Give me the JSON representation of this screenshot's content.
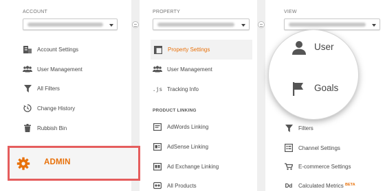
{
  "account": {
    "heading": "ACCOUNT",
    "items": [
      {
        "label": "Account Settings",
        "icon": "building-icon"
      },
      {
        "label": "User Management",
        "icon": "users-icon"
      },
      {
        "label": "All Filters",
        "icon": "filter-icon"
      },
      {
        "label": "Change History",
        "icon": "history-icon"
      },
      {
        "label": "Rubbish Bin",
        "icon": "trash-icon"
      }
    ],
    "admin_label": "ADMIN"
  },
  "property": {
    "heading": "PROPERTY",
    "items": [
      {
        "label": "Property Settings",
        "icon": "property-settings-icon"
      },
      {
        "label": "User Management",
        "icon": "users-icon"
      },
      {
        "label": "Tracking Info",
        "icon": "js-icon"
      }
    ],
    "section_heading": "PRODUCT LINKING",
    "linking": [
      {
        "label": "AdWords Linking",
        "icon": "adwords-icon"
      },
      {
        "label": "AdSense Linking",
        "icon": "adsense-icon"
      },
      {
        "label": "Ad Exchange Linking",
        "icon": "adexchange-icon"
      },
      {
        "label": "All Products",
        "icon": "all-products-icon"
      }
    ]
  },
  "view": {
    "heading": "VIEW",
    "items": [
      {
        "label": "Filters",
        "icon": "filter-icon"
      },
      {
        "label": "Channel Settings",
        "icon": "channel-settings-icon"
      },
      {
        "label": "E-commerce Settings",
        "icon": "cart-icon"
      },
      {
        "label": "Calculated Metrics",
        "icon": "dd-icon",
        "badge": "BETA"
      }
    ],
    "magnified": {
      "users_partial": "User",
      "goals": "Goals"
    }
  },
  "colors": {
    "accent": "#e8710a",
    "highlight_border": "#e55d5d"
  }
}
